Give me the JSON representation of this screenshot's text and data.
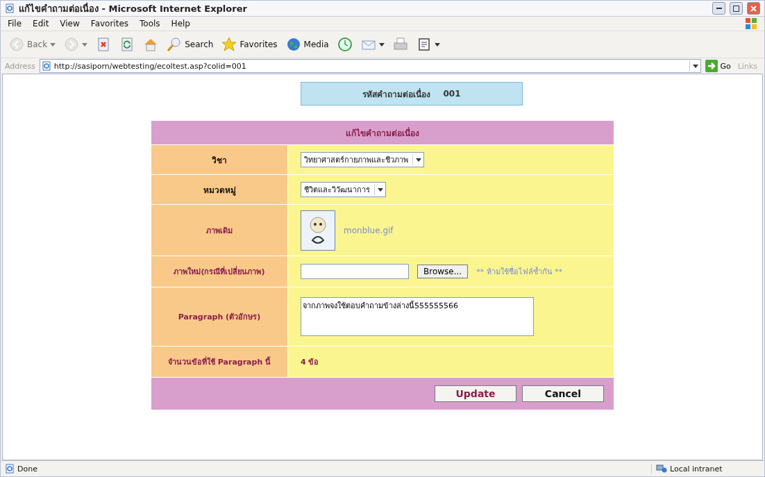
{
  "window": {
    "title": "แก้ไขคำถามต่อเนื่อง - Microsoft Internet Explorer"
  },
  "menu": [
    "File",
    "Edit",
    "View",
    "Favorites",
    "Tools",
    "Help"
  ],
  "toolbar": [
    {
      "kind": "back",
      "label": "Back",
      "disabled": true
    },
    {
      "kind": "forward",
      "disabled": true
    },
    {
      "kind": "stop",
      "disabled": false
    },
    {
      "kind": "refresh",
      "disabled": false
    },
    {
      "kind": "home",
      "disabled": false
    },
    {
      "kind": "search",
      "label": "Search",
      "disabled": false
    },
    {
      "kind": "favorites",
      "label": "Favorites",
      "disabled": false
    },
    {
      "kind": "media",
      "label": "Media",
      "disabled": false
    },
    {
      "kind": "history",
      "disabled": false
    },
    {
      "kind": "mail",
      "disabled": false
    },
    {
      "kind": "print",
      "disabled": false
    },
    {
      "kind": "edit",
      "disabled": false
    }
  ],
  "address": {
    "label": "Address",
    "url": "http://sasiporn/webtesting/ecoltest.asp?colid=001",
    "go": "Go",
    "links": "Links"
  },
  "code_box": {
    "label": "รหัสคำถามต่อเนื่อง",
    "value": "001"
  },
  "form": {
    "title": "แก้ไขคำถามต่อเนื่อง",
    "rows": [
      {
        "kind": "select",
        "label": "วิชา",
        "value": "วิทยาศาสตร์กายภาพและชีวภาพ"
      },
      {
        "kind": "select",
        "label": "หมวดหมู่",
        "value": "ชีวิตและวิวัฒนาการ"
      },
      {
        "kind": "image",
        "label": "ภาพเดิม",
        "filename": "monblue.gif"
      },
      {
        "kind": "file",
        "label": "ภาพใหม่(กรณีที่เปลี่ยนภาพ)",
        "button": "Browse...",
        "note": "** ห้ามใช้ชื่อไฟล์ซ้ำกัน **"
      },
      {
        "kind": "textarea",
        "label": "Paragraph (ตัวอักษร)",
        "value": "จากภาพจงใช้ตอบคำถามข้างล่างนี้555555566"
      },
      {
        "kind": "text",
        "label": "จำนวนข้อที่ใช้ Paragraph นี้",
        "value": "4 ข้อ"
      }
    ],
    "buttons": [
      "Update",
      "Cancel"
    ]
  },
  "status": {
    "text": "Done",
    "zone": "Local intranet"
  }
}
